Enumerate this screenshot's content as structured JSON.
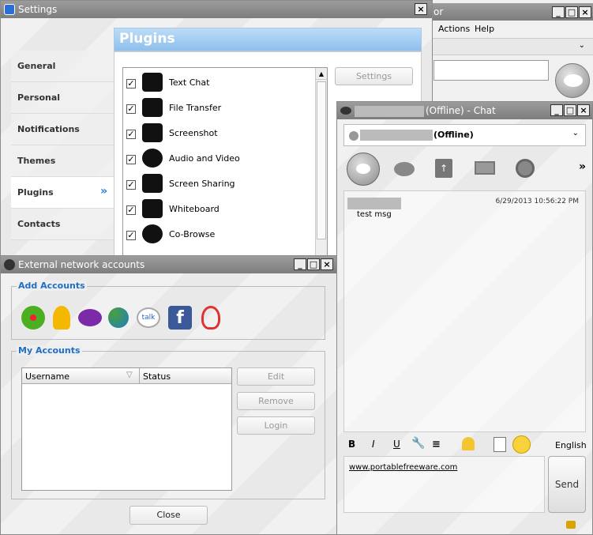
{
  "settings": {
    "title": "Settings",
    "heading": "Plugins",
    "nav": [
      {
        "label": "General"
      },
      {
        "label": "Personal"
      },
      {
        "label": "Notifications"
      },
      {
        "label": "Themes"
      },
      {
        "label": "Plugins",
        "active": true
      },
      {
        "label": "Contacts"
      }
    ],
    "nav_active_marker": "»",
    "plugins": [
      {
        "label": "Text Chat",
        "icon": "chat-bubble-icon",
        "checked": true
      },
      {
        "label": "File Transfer",
        "icon": "file-transfer-icon",
        "checked": true
      },
      {
        "label": "Screenshot",
        "icon": "monitor-icon",
        "checked": true
      },
      {
        "label": "Audio and Video",
        "icon": "headset-icon",
        "checked": true
      },
      {
        "label": "Screen Sharing",
        "icon": "screen-sharing-icon",
        "checked": true
      },
      {
        "label": "Whiteboard",
        "icon": "whiteboard-icon",
        "checked": true
      },
      {
        "label": "Co-Browse",
        "icon": "globe-icon",
        "checked": true
      }
    ],
    "settings_button": "Settings"
  },
  "main_window": {
    "menu": [
      "Actions",
      "Help"
    ],
    "title_fragment": "or"
  },
  "chat": {
    "title": "(Offline) - Chat",
    "contact_status": "(Offline)",
    "timestamp": "6/29/2013 10:56:22 PM",
    "message": "test msg",
    "input_text": "www.portablefreeware.com",
    "language": "English",
    "send_label": "Send",
    "more_marker": "»",
    "toolbar_icons": [
      "talk-icon",
      "chat-bubble-icon",
      "file-transfer-icon",
      "monitor-icon",
      "headset-icon"
    ],
    "format": {
      "bold": "B",
      "italic": "I",
      "underline": "U"
    }
  },
  "ext": {
    "title": "External network accounts",
    "add_accounts_label": "Add Accounts",
    "my_accounts_label": "My Accounts",
    "networks": [
      "icq-flower-icon",
      "aim-icon",
      "yahoo-icon",
      "msn-icon",
      "google-talk-icon",
      "facebook-icon",
      "jabber-icon"
    ],
    "columns": [
      "Username",
      "Status"
    ],
    "buttons": {
      "edit": "Edit",
      "remove": "Remove",
      "login": "Login",
      "close": "Close"
    }
  }
}
